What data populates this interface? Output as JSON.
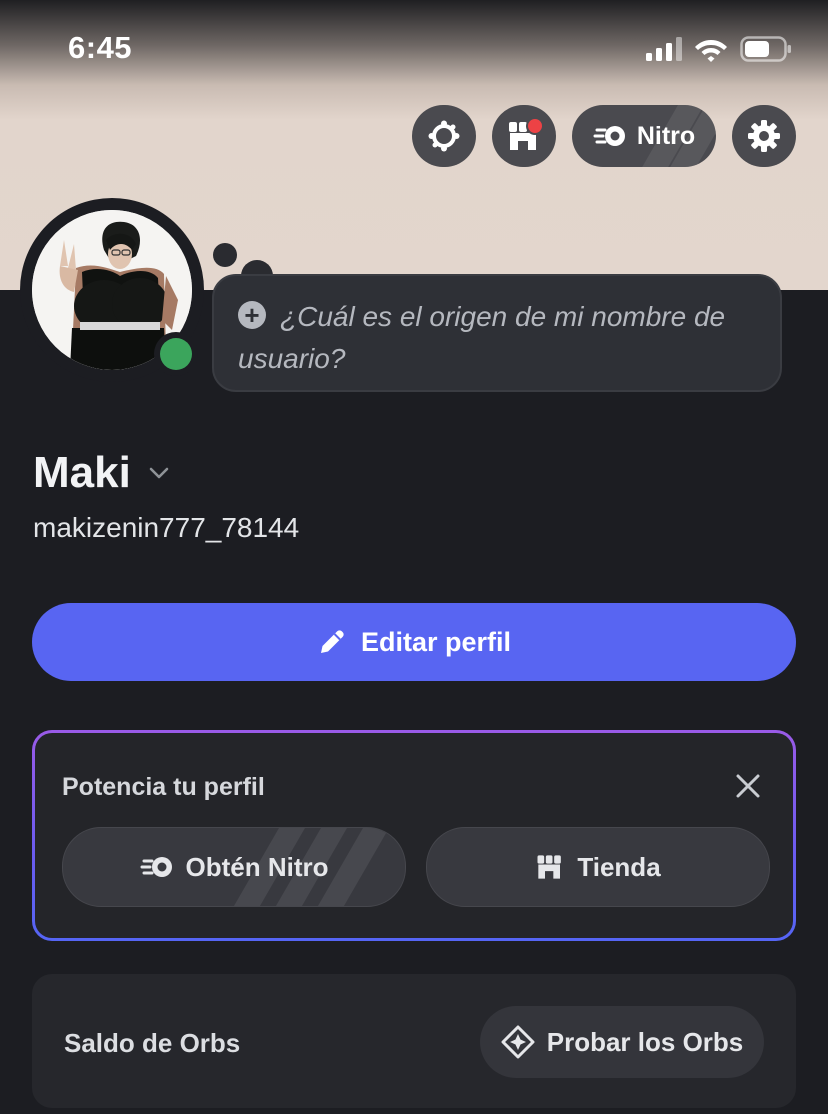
{
  "status_bar": {
    "time": "6:45"
  },
  "top_actions": {
    "nitro_label": "Nitro"
  },
  "custom_status": {
    "placeholder": "¿Cuál es el origen de mi nombre de usuario?"
  },
  "profile": {
    "display_name": "Maki",
    "username": "makizenin777_78144"
  },
  "edit_profile": {
    "label": "Editar perfil"
  },
  "boost_card": {
    "title": "Potencia tu perfil",
    "nitro_label": "Obtén Nitro",
    "shop_label": "Tienda"
  },
  "orbs": {
    "title": "Saldo de Orbs",
    "button_label": "Probar los Orbs"
  },
  "colors": {
    "accent": "#5865f2",
    "online": "#3ba55c",
    "background": "#1c1d22"
  }
}
